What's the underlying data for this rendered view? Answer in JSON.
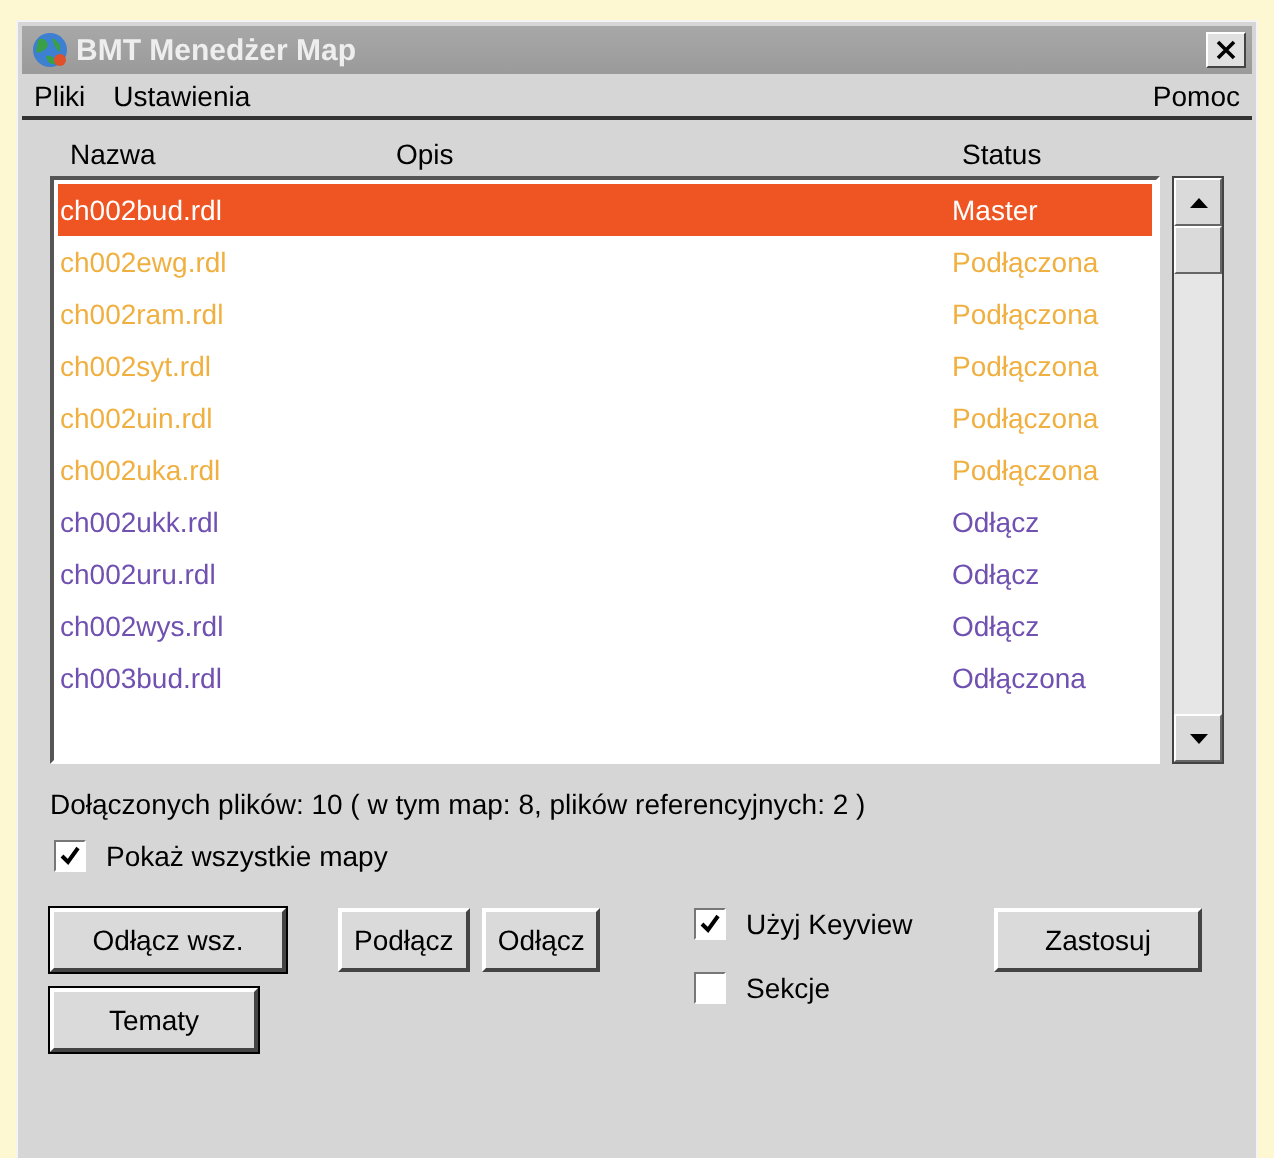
{
  "window": {
    "title": "BMT Menedżer Map"
  },
  "menu": {
    "left": [
      "Pliki",
      "Ustawienia"
    ],
    "right": [
      "Pomoc"
    ]
  },
  "table": {
    "columns": [
      "Nazwa",
      "Opis",
      "Status"
    ],
    "rows": [
      {
        "name": "ch002bud.rdl",
        "status": "Master",
        "selected": true,
        "color": "#ffffff"
      },
      {
        "name": "ch002ewg.rdl",
        "status": "Podłączona",
        "selected": false,
        "color": "#f0b040"
      },
      {
        "name": "ch002ram.rdl",
        "status": "Podłączona",
        "selected": false,
        "color": "#f0b040"
      },
      {
        "name": "ch002syt.rdl",
        "status": "Podłączona",
        "selected": false,
        "color": "#f0b040"
      },
      {
        "name": "ch002uin.rdl",
        "status": "Podłączona",
        "selected": false,
        "color": "#f0b040"
      },
      {
        "name": "ch002uka.rdl",
        "status": "Podłączona",
        "selected": false,
        "color": "#f0b040"
      },
      {
        "name": "ch002ukk.rdl",
        "status": "Odłącz",
        "selected": false,
        "color": "#7050b0"
      },
      {
        "name": "ch002uru.rdl",
        "status": "Odłącz",
        "selected": false,
        "color": "#7050b0"
      },
      {
        "name": "ch002wys.rdl",
        "status": "Odłącz",
        "selected": false,
        "color": "#7050b0"
      },
      {
        "name": "ch003bud.rdl",
        "status": "Odłączona",
        "selected": false,
        "color": "#7050b0"
      }
    ]
  },
  "summary": "Dołączonych plików: 10 ( w tym map: 8, plików referencyjnych: 2 )",
  "show_all": {
    "label": "Pokaż wszystkie mapy",
    "checked": true
  },
  "buttons": {
    "detach_all": "Odłącz wsz.",
    "attach": "Podłącz",
    "detach": "Odłącz",
    "apply": "Zastosuj",
    "themes": "Tematy"
  },
  "options": [
    {
      "label": "Użyj Keyview",
      "checked": true
    },
    {
      "label": "Sekcje",
      "checked": false
    }
  ]
}
